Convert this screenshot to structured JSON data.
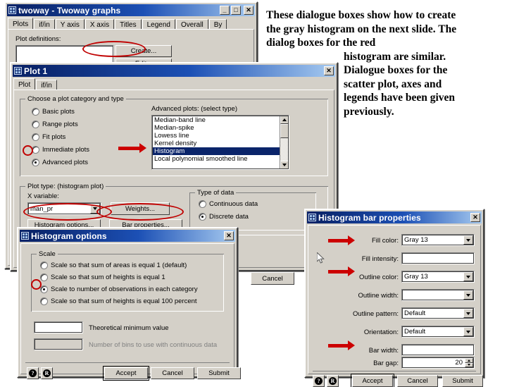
{
  "narrative": {
    "line1": "These dialogue boxes show how to create",
    "line2": "the gray histogram on the next slide.  The",
    "line3": "dialog boxes for the red",
    "line4": "histogram are similar.",
    "line5": "Dialogue boxes for the",
    "line6": "scatter plot, axes and",
    "line7": "legends have been given",
    "line8": "previously."
  },
  "colors": {
    "annotation_red": "#cc0000",
    "title_blue": "#0a246a",
    "selection_blue": "#0a246a",
    "dialog_face": "#d4d0c8"
  },
  "twoway_window": {
    "title": "twoway - Twoway graphs",
    "icon": "stata-dialog-icon",
    "buttons": {
      "minimize": "_",
      "maximize": "□",
      "close": "✕"
    },
    "tabs": [
      {
        "label": "Plots",
        "active": true
      },
      {
        "label": "if/in",
        "active": false
      },
      {
        "label": "Y axis",
        "active": false
      },
      {
        "label": "X axis",
        "active": false
      },
      {
        "label": "Titles",
        "active": false
      },
      {
        "label": "Legend",
        "active": false
      },
      {
        "label": "Overall",
        "active": false
      },
      {
        "label": "By",
        "active": false
      }
    ],
    "plot_definitions_label": "Plot definitions:",
    "plot_definitions_items": [],
    "create_button": "Create...",
    "edit_button": "Edit...",
    "cancel_button": "Cancel"
  },
  "plot1_window": {
    "title": "Plot 1",
    "icon": "stata-dialog-icon",
    "close_button": "✕",
    "tabs": [
      {
        "label": "Plot",
        "active": true
      },
      {
        "label": "if/in",
        "active": false
      }
    ],
    "category_group_label": "Choose a plot category and type",
    "categories": [
      {
        "label": "Basic plots",
        "selected": false
      },
      {
        "label": "Range plots",
        "selected": false
      },
      {
        "label": "Fit plots",
        "selected": false
      },
      {
        "label": "Immediate plots",
        "selected": false
      },
      {
        "label": "Advanced plots",
        "selected": true
      }
    ],
    "advanced_list_label": "Advanced plots: (select type)",
    "advanced_items": [
      {
        "label": "Median-band line",
        "selected": false
      },
      {
        "label": "Median-spike",
        "selected": false
      },
      {
        "label": "Lowess line",
        "selected": false
      },
      {
        "label": "Kernel density",
        "selected": false
      },
      {
        "label": "Histogram",
        "selected": true
      },
      {
        "label": "Local polynomial smoothed line",
        "selected": false
      }
    ],
    "plottype_group_label": "Plot type: (histogram plot)",
    "xvariable_label": "X variable:",
    "xvariable_value": "man_pr",
    "weights_button": "Weights...",
    "histogram_options_button": "Histogram options...",
    "bar_properties_button": "Bar properties...",
    "typeofdata_group_label": "Type of data",
    "typeofdata_options": [
      {
        "label": "Continuous data",
        "selected": false
      },
      {
        "label": "Discrete data",
        "selected": true
      }
    ]
  },
  "histogram_options_window": {
    "title": "Histogram options",
    "icon": "stata-dialog-icon",
    "close_button": "✕",
    "scale_group_label": "Scale",
    "scale_options": [
      {
        "label": "Scale so that sum of areas is equal 1 (default)",
        "selected": false
      },
      {
        "label": "Scale so that sum of heights is equal 1",
        "selected": false
      },
      {
        "label": "Scale to number of observations in each category",
        "selected": true
      },
      {
        "label": "Scale so that sum of heights is equal 100 percent",
        "selected": false
      }
    ],
    "theoretical_min_label": "Theoretical minimum value",
    "theoretical_min_value": "",
    "bins_label": "Number of bins to use with continuous data",
    "bins_value": "",
    "help_button": "?",
    "reset_button": "R",
    "accept_button": "Accept",
    "cancel_button": "Cancel",
    "submit_button": "Submit"
  },
  "bar_properties_window": {
    "title": "Histogram bar properties",
    "icon": "stata-dialog-icon",
    "close_button": "✕",
    "fields": [
      {
        "label": "Fill color:",
        "value": "Gray 13",
        "type": "combo",
        "highlighted": true
      },
      {
        "label": "Fill intensity:",
        "value": "",
        "type": "text",
        "highlighted": false
      },
      {
        "label": "Outline color:",
        "value": "Gray 13",
        "type": "combo",
        "highlighted": true
      },
      {
        "label": "Outline width:",
        "value": "",
        "type": "combo",
        "highlighted": false
      },
      {
        "label": "Outline pattern:",
        "value": "Default",
        "type": "combo",
        "highlighted": false
      },
      {
        "label": "Orientation:",
        "value": "Default",
        "type": "combo",
        "highlighted": false
      },
      {
        "label": "Bar width:",
        "value": "",
        "type": "text",
        "highlighted": false
      },
      {
        "label": "Bar gap:",
        "value": "20",
        "type": "spinner",
        "highlighted": true
      }
    ],
    "help_button": "?",
    "reset_button": "R",
    "accept_button": "Accept",
    "cancel_button": "Cancel",
    "submit_button": "Submit"
  }
}
